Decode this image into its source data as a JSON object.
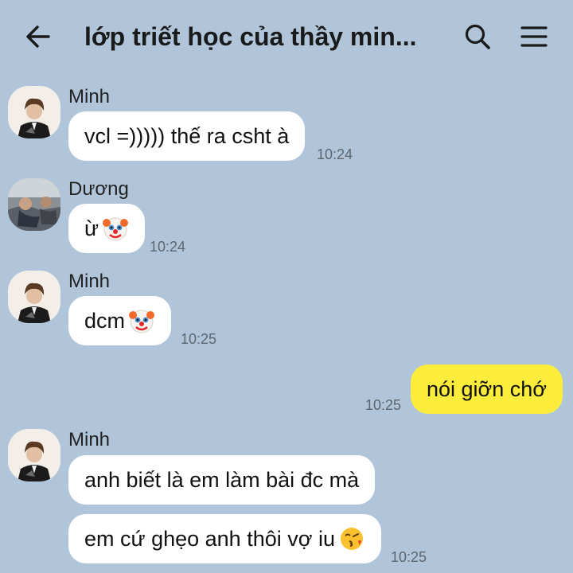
{
  "header": {
    "title": "lớp triết học của thầy min...",
    "back_icon": "arrow-left-icon",
    "search_icon": "search-icon",
    "menu_icon": "menu-icon"
  },
  "messages": [
    {
      "sender": "Minh",
      "text": "vcl =))))) thế ra csht à",
      "time": "10:24"
    },
    {
      "sender": "Dương",
      "text": "ừ",
      "emoji": "clown-face",
      "time": "10:24"
    },
    {
      "sender": "Minh",
      "text": "dcm",
      "emoji": "clown-face",
      "time": "10:25"
    },
    {
      "sender": "me",
      "text": "nói giỡn chớ",
      "time": "10:25"
    },
    {
      "sender": "Minh",
      "text": "anh biết là em làm bài đc mà"
    },
    {
      "text": "em cứ ghẹo anh thôi vợ iu",
      "emoji": "face-blowing-kiss",
      "time": "10:25"
    }
  ],
  "colors": {
    "background": "#b1c5da",
    "incoming_bubble": "#ffffff",
    "outgoing_bubble": "#fcec3c"
  }
}
